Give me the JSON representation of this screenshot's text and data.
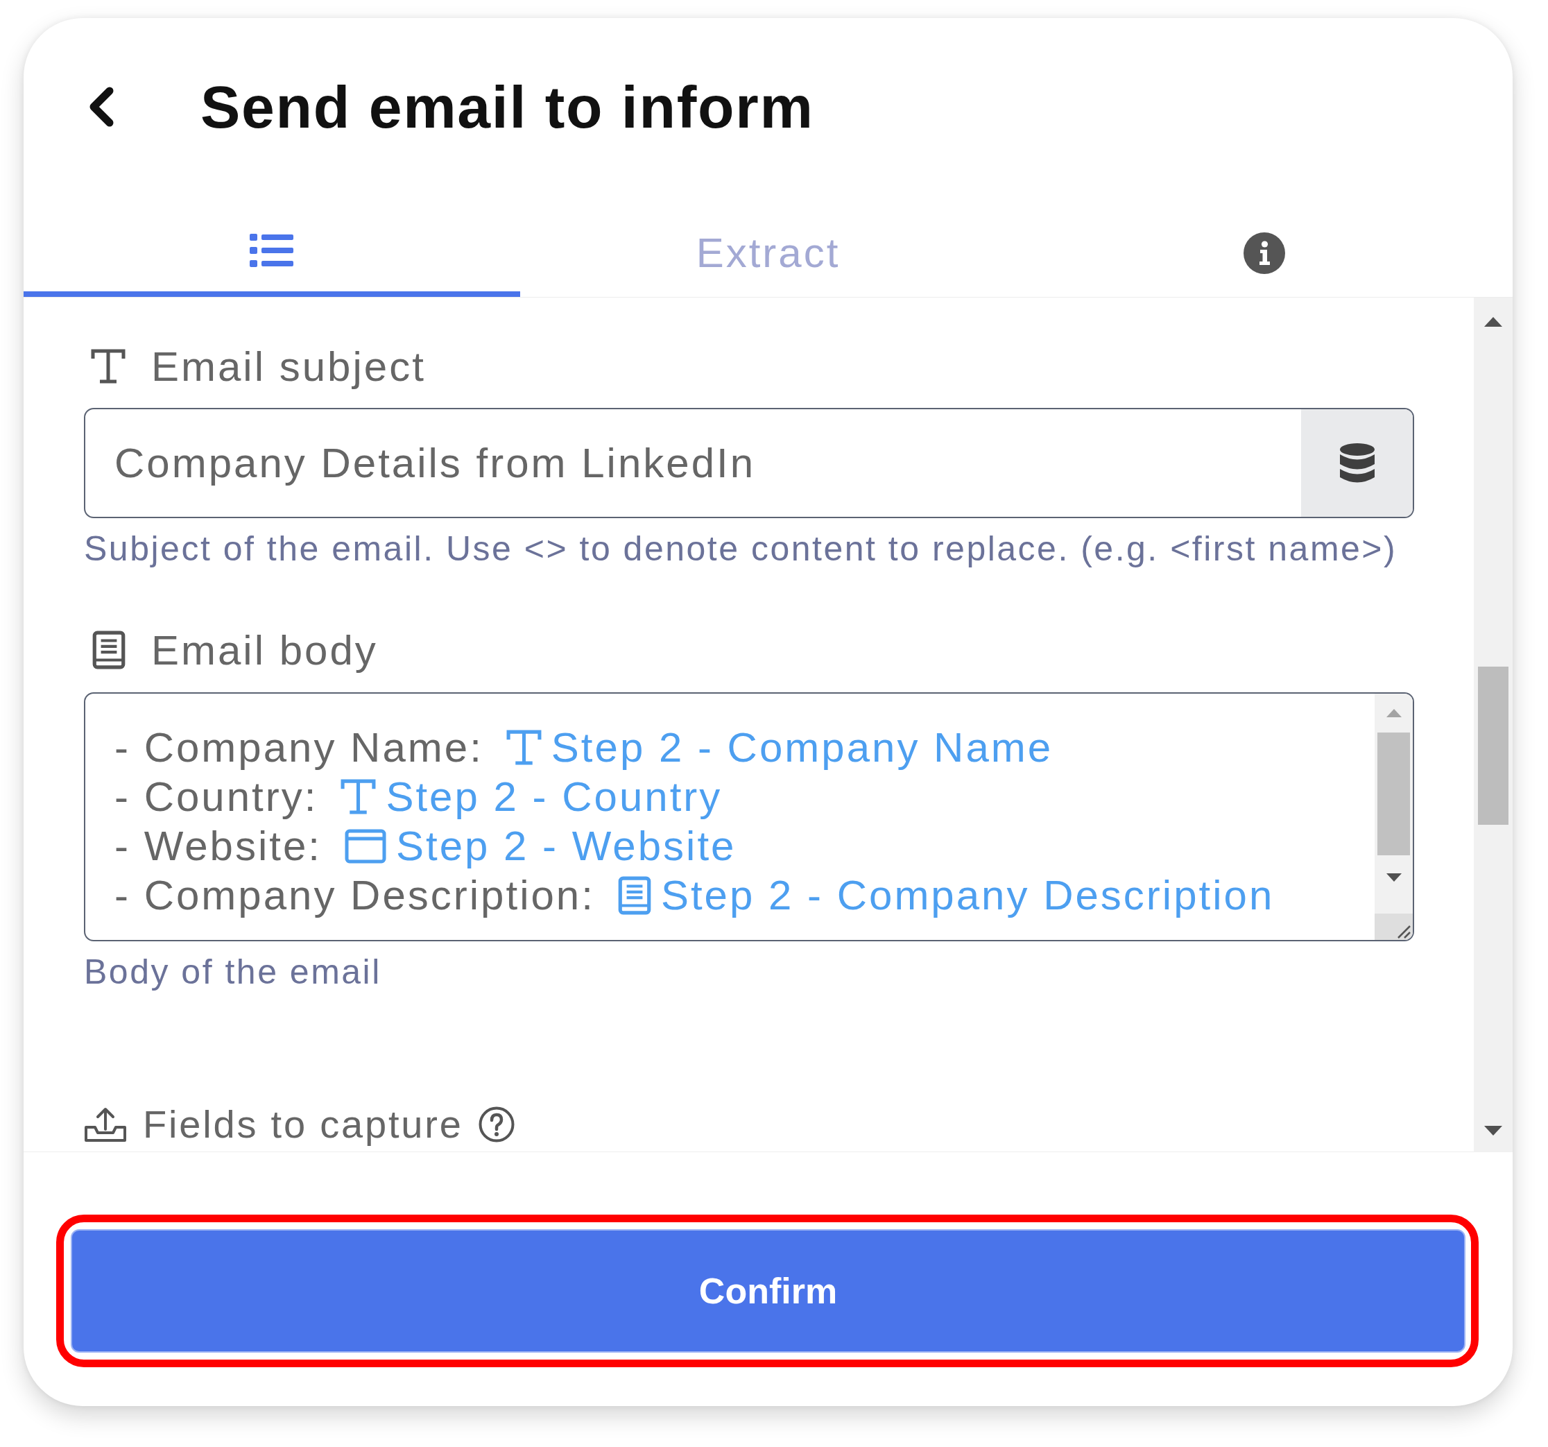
{
  "header": {
    "title": "Send email to inform"
  },
  "tabs": [
    {
      "kind": "list",
      "selected": true
    },
    {
      "kind": "text",
      "label": "Extract",
      "selected": false
    },
    {
      "kind": "info",
      "selected": false
    }
  ],
  "fields": [
    {
      "kind": "text",
      "label": "Email subject",
      "value": "Company Details from LinkedIn",
      "help": "Subject of the email. Use <> to denote content to replace. (e.g. <first name>)"
    },
    {
      "kind": "long-text",
      "label": "Email body",
      "lines": [
        {
          "text": "- Company Name:",
          "token": {
            "kind": "text",
            "label": "Step 2 - Company Name"
          }
        },
        {
          "text": "- Country:",
          "token": {
            "kind": "text",
            "label": "Step 2 - Country"
          }
        },
        {
          "text": "- Website:",
          "token": {
            "kind": "url",
            "label": "Step 2 - Website"
          }
        },
        {
          "text": "- Company Description:",
          "token": {
            "kind": "long-text",
            "label": "Step 2 - Company Description"
          }
        }
      ],
      "help": "Body of the email"
    },
    {
      "kind": "capture",
      "label": "Fields to capture"
    }
  ],
  "footer": {
    "button": {
      "label": "Confirm",
      "highlighted": true
    }
  }
}
